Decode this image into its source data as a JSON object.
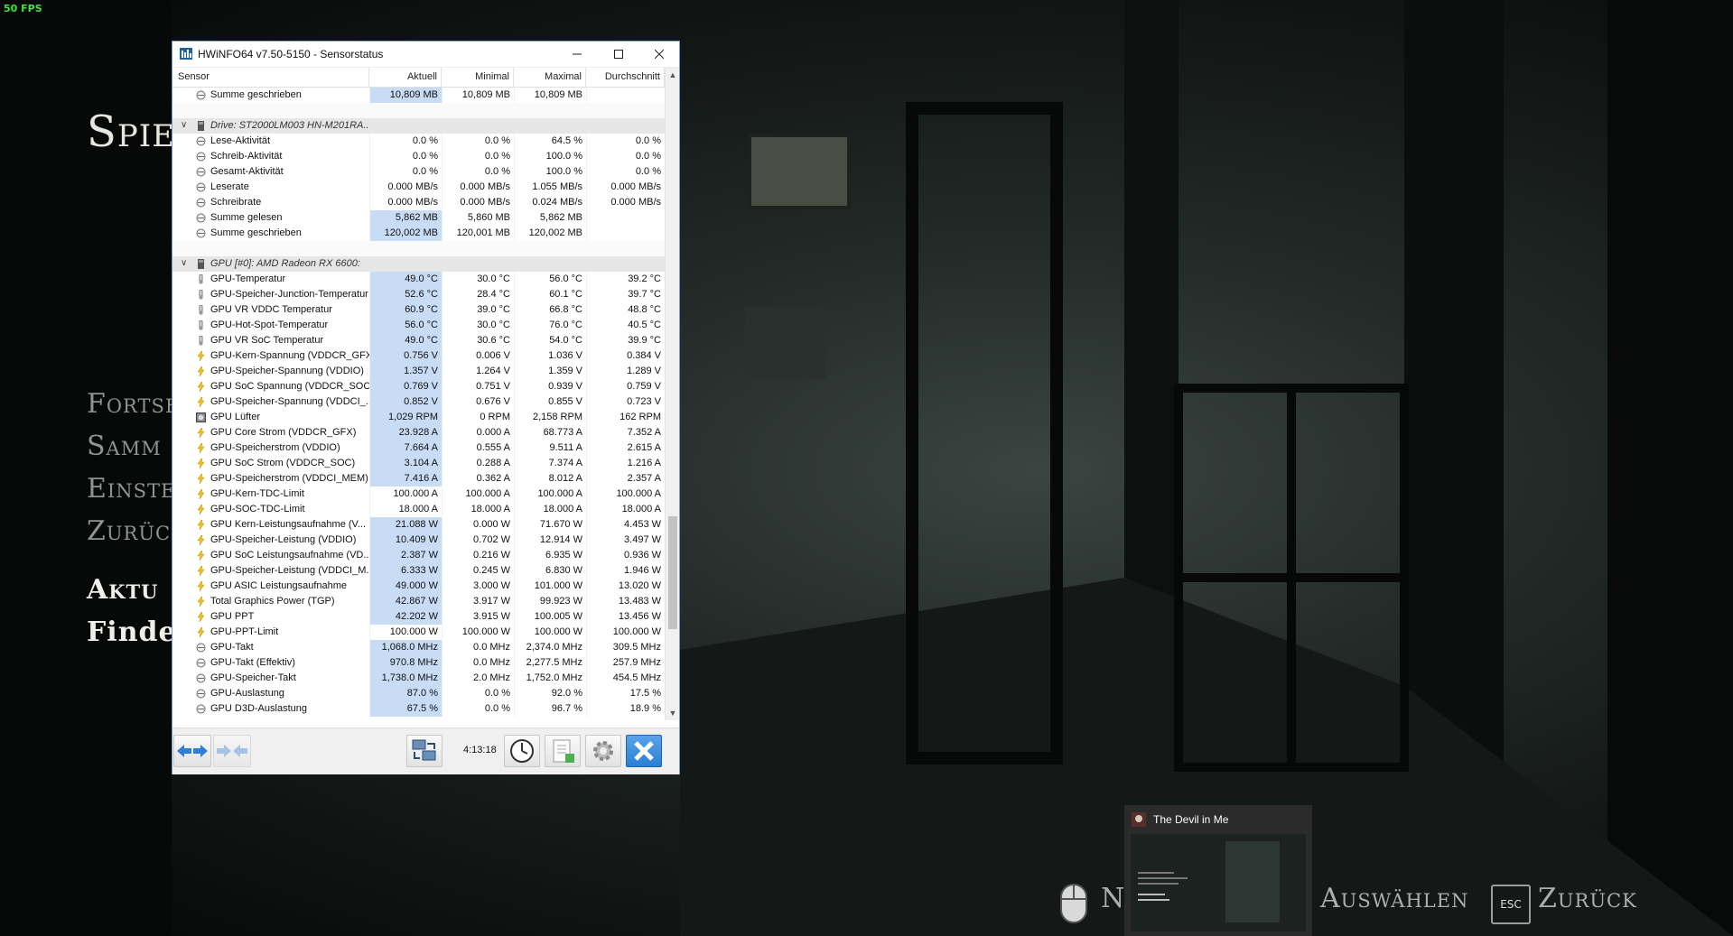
{
  "fps": "50 FPS",
  "game_menu": {
    "title": "Spiel",
    "items": [
      "Fortsetzen",
      "Sammlung",
      "Einstellungen",
      "Zurück"
    ],
    "item_visible": [
      "Fortse",
      "Samm",
      "Einste",
      "Zurüc"
    ],
    "bright_1": "Aktu",
    "bright_2": "Finde"
  },
  "bottom_hints": {
    "select_label": "Auswählen",
    "select_partial": "N",
    "esc_key": "ESC",
    "back_label": "Zurück"
  },
  "taskbar_preview": {
    "title": "The Devil in Me"
  },
  "hwinfo": {
    "title": "HWiNFO64 v7.50-5150 - Sensorstatus",
    "columns": [
      "Sensor",
      "Aktuell",
      "Minimal",
      "Maximal",
      "Durchschnitt"
    ],
    "timer": "4:13:18",
    "rows": [
      {
        "type": "sensor",
        "icon": "circle",
        "name": "Summe geschrieben",
        "cur": "10,809 MB",
        "min": "10,809 MB",
        "max": "10,809 MB",
        "avg": "",
        "hl": true
      },
      {
        "type": "blank"
      },
      {
        "type": "group",
        "name": "Drive: ST2000LM003 HN-M201RA..."
      },
      {
        "type": "sensor",
        "icon": "circle",
        "name": "Lese-Aktivität",
        "cur": "0.0 %",
        "min": "0.0 %",
        "max": "64.5 %",
        "avg": "0.0 %"
      },
      {
        "type": "sensor",
        "icon": "circle",
        "name": "Schreib-Aktivität",
        "cur": "0.0 %",
        "min": "0.0 %",
        "max": "100.0 %",
        "avg": "0.0 %"
      },
      {
        "type": "sensor",
        "icon": "circle",
        "name": "Gesamt-Aktivität",
        "cur": "0.0 %",
        "min": "0.0 %",
        "max": "100.0 %",
        "avg": "0.0 %"
      },
      {
        "type": "sensor",
        "icon": "circle",
        "name": "Leserate",
        "cur": "0.000 MB/s",
        "min": "0.000 MB/s",
        "max": "1.055 MB/s",
        "avg": "0.000 MB/s"
      },
      {
        "type": "sensor",
        "icon": "circle",
        "name": "Schreibrate",
        "cur": "0.000 MB/s",
        "min": "0.000 MB/s",
        "max": "0.024 MB/s",
        "avg": "0.000 MB/s"
      },
      {
        "type": "sensor",
        "icon": "circle",
        "name": "Summe gelesen",
        "cur": "5,862 MB",
        "min": "5,860 MB",
        "max": "5,862 MB",
        "avg": "",
        "hl": true
      },
      {
        "type": "sensor",
        "icon": "circle",
        "name": "Summe geschrieben",
        "cur": "120,002 MB",
        "min": "120,001 MB",
        "max": "120,002 MB",
        "avg": "",
        "hl": true
      },
      {
        "type": "blank"
      },
      {
        "type": "group",
        "name": "GPU [#0]: AMD Radeon RX 6600:"
      },
      {
        "type": "sensor",
        "icon": "thermo",
        "name": "GPU-Temperatur",
        "cur": "49.0 °C",
        "min": "30.0 °C",
        "max": "56.0 °C",
        "avg": "39.2 °C",
        "hl": true
      },
      {
        "type": "sensor",
        "icon": "thermo",
        "name": "GPU-Speicher-Junction-Temperatur",
        "cur": "52.6 °C",
        "min": "28.4 °C",
        "max": "60.1 °C",
        "avg": "39.7 °C",
        "hl": true
      },
      {
        "type": "sensor",
        "icon": "thermo",
        "name": "GPU VR VDDC Temperatur",
        "cur": "60.9 °C",
        "min": "39.0 °C",
        "max": "66.8 °C",
        "avg": "48.8 °C",
        "hl": true
      },
      {
        "type": "sensor",
        "icon": "thermo",
        "name": "GPU-Hot-Spot-Temperatur",
        "cur": "56.0 °C",
        "min": "30.0 °C",
        "max": "76.0 °C",
        "avg": "40.5 °C",
        "hl": true
      },
      {
        "type": "sensor",
        "icon": "thermo",
        "name": "GPU VR SoC Temperatur",
        "cur": "49.0 °C",
        "min": "30.6 °C",
        "max": "54.0 °C",
        "avg": "39.9 °C",
        "hl": true
      },
      {
        "type": "sensor",
        "icon": "bolt",
        "name": "GPU-Kern-Spannung (VDDCR_GFX)",
        "cur": "0.756 V",
        "min": "0.006 V",
        "max": "1.036 V",
        "avg": "0.384 V",
        "hl": true
      },
      {
        "type": "sensor",
        "icon": "bolt",
        "name": "GPU-Speicher-Spannung (VDDIO)",
        "cur": "1.357 V",
        "min": "1.264 V",
        "max": "1.359 V",
        "avg": "1.289 V",
        "hl": true
      },
      {
        "type": "sensor",
        "icon": "bolt",
        "name": "GPU SoC Spannung (VDDCR_SOC)",
        "cur": "0.769 V",
        "min": "0.751 V",
        "max": "0.939 V",
        "avg": "0.759 V",
        "hl": true
      },
      {
        "type": "sensor",
        "icon": "bolt",
        "name": "GPU-Speicher-Spannung (VDDCI_...",
        "cur": "0.852 V",
        "min": "0.676 V",
        "max": "0.855 V",
        "avg": "0.723 V",
        "hl": true
      },
      {
        "type": "sensor",
        "icon": "fan",
        "name": "GPU Lüfter",
        "cur": "1,029 RPM",
        "min": "0 RPM",
        "max": "2,158 RPM",
        "avg": "162 RPM",
        "hl": true
      },
      {
        "type": "sensor",
        "icon": "bolt",
        "name": "GPU Core Strom (VDDCR_GFX)",
        "cur": "23.928 A",
        "min": "0.000 A",
        "max": "68.773 A",
        "avg": "7.352 A",
        "hl": true
      },
      {
        "type": "sensor",
        "icon": "bolt",
        "name": "GPU-Speicherstrom (VDDIO)",
        "cur": "7.664 A",
        "min": "0.555 A",
        "max": "9.511 A",
        "avg": "2.615 A",
        "hl": true
      },
      {
        "type": "sensor",
        "icon": "bolt",
        "name": "GPU SoC Strom (VDDCR_SOC)",
        "cur": "3.104 A",
        "min": "0.288 A",
        "max": "7.374 A",
        "avg": "1.216 A",
        "hl": true
      },
      {
        "type": "sensor",
        "icon": "bolt",
        "name": "GPU-Speicherstrom (VDDCI_MEM)",
        "cur": "7.416 A",
        "min": "0.362 A",
        "max": "8.012 A",
        "avg": "2.357 A",
        "hl": true
      },
      {
        "type": "sensor",
        "icon": "bolt",
        "name": "GPU-Kern-TDC-Limit",
        "cur": "100.000 A",
        "min": "100.000 A",
        "max": "100.000 A",
        "avg": "100.000 A"
      },
      {
        "type": "sensor",
        "icon": "bolt",
        "name": "GPU-SOC-TDC-Limit",
        "cur": "18.000 A",
        "min": "18.000 A",
        "max": "18.000 A",
        "avg": "18.000 A"
      },
      {
        "type": "sensor",
        "icon": "bolt",
        "name": "GPU Kern-Leistungsaufnahme (V...",
        "cur": "21.088 W",
        "min": "0.000 W",
        "max": "71.670 W",
        "avg": "4.453 W",
        "hl": true
      },
      {
        "type": "sensor",
        "icon": "bolt",
        "name": "GPU-Speicher-Leistung (VDDIO)",
        "cur": "10.409 W",
        "min": "0.702 W",
        "max": "12.914 W",
        "avg": "3.497 W",
        "hl": true
      },
      {
        "type": "sensor",
        "icon": "bolt",
        "name": "GPU SoC Leistungsaufnahme (VD...",
        "cur": "2.387 W",
        "min": "0.216 W",
        "max": "6.935 W",
        "avg": "0.936 W",
        "hl": true
      },
      {
        "type": "sensor",
        "icon": "bolt",
        "name": "GPU-Speicher-Leistung (VDDCI_M...",
        "cur": "6.333 W",
        "min": "0.245 W",
        "max": "6.830 W",
        "avg": "1.946 W",
        "hl": true
      },
      {
        "type": "sensor",
        "icon": "bolt",
        "name": "GPU ASIC Leistungsaufnahme",
        "cur": "49.000 W",
        "min": "3.000 W",
        "max": "101.000 W",
        "avg": "13.020 W",
        "hl": true
      },
      {
        "type": "sensor",
        "icon": "bolt",
        "name": "Total Graphics Power (TGP)",
        "cur": "42.867 W",
        "min": "3.917 W",
        "max": "99.923 W",
        "avg": "13.483 W",
        "hl": true
      },
      {
        "type": "sensor",
        "icon": "bolt",
        "name": "GPU PPT",
        "cur": "42.202 W",
        "min": "3.915 W",
        "max": "100.005 W",
        "avg": "13.456 W",
        "hl": true
      },
      {
        "type": "sensor",
        "icon": "bolt",
        "name": "GPU-PPT-Limit",
        "cur": "100.000 W",
        "min": "100.000 W",
        "max": "100.000 W",
        "avg": "100.000 W"
      },
      {
        "type": "sensor",
        "icon": "circle",
        "name": "GPU-Takt",
        "cur": "1,068.0 MHz",
        "min": "0.0 MHz",
        "max": "2,374.0 MHz",
        "avg": "309.5 MHz",
        "hl": true
      },
      {
        "type": "sensor",
        "icon": "circle",
        "name": "GPU-Takt (Effektiv)",
        "cur": "970.8 MHz",
        "min": "0.0 MHz",
        "max": "2,277.5 MHz",
        "avg": "257.9 MHz",
        "hl": true
      },
      {
        "type": "sensor",
        "icon": "circle",
        "name": "GPU-Speicher-Takt",
        "cur": "1,738.0 MHz",
        "min": "2.0 MHz",
        "max": "1,752.0 MHz",
        "avg": "454.5 MHz",
        "hl": true
      },
      {
        "type": "sensor",
        "icon": "circle",
        "name": "GPU-Auslastung",
        "cur": "87.0 %",
        "min": "0.0 %",
        "max": "92.0 %",
        "avg": "17.5 %",
        "hl": true
      },
      {
        "type": "sensor",
        "icon": "circle",
        "name": "GPU D3D-Auslastung",
        "cur": "67.5 %",
        "min": "0.0 %",
        "max": "96.7 %",
        "avg": "18.9 %",
        "hl": true
      }
    ]
  },
  "colors": {
    "highlight": "#c9dcf5",
    "fps_green": "#3fe23f",
    "close_button": "#2a7fd4"
  }
}
